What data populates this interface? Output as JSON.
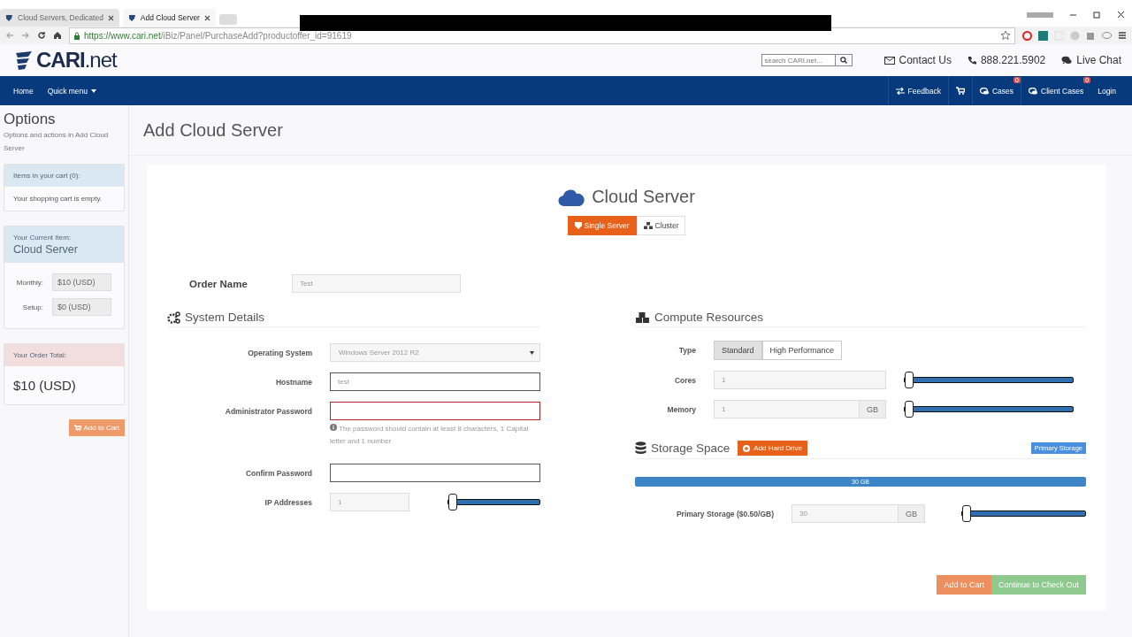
{
  "browser": {
    "tabs": [
      {
        "label": "Cloud Servers, Dedicated",
        "selected": false
      },
      {
        "label": "Add Cloud Server",
        "selected": true
      }
    ],
    "url_host": "https://www.cari.net",
    "url_path": "/iBiz/Panel/PurchaseAdd?productoffer_id=91619"
  },
  "header": {
    "logo_main": "CARI",
    "logo_suffix": ".net",
    "search": {
      "placeholder": "search CARI.net..."
    },
    "links": [
      {
        "label": "Contact Us",
        "kind": "mail"
      },
      {
        "label": "888.221.5902",
        "kind": "phone"
      },
      {
        "label": "Live Chat",
        "kind": "chat"
      }
    ]
  },
  "nav": {
    "left": [
      {
        "label": "Home",
        "kind": "link"
      },
      {
        "label": "Quick menu",
        "kind": "dropdown"
      }
    ],
    "right": [
      {
        "label": "Feedback",
        "kind": "feedback"
      },
      {
        "kind": "cart"
      },
      {
        "label": "Cases",
        "kind": "cases",
        "badge": "0"
      },
      {
        "label": "Client Cases",
        "kind": "cases",
        "badge": "0"
      },
      {
        "label": "Login",
        "kind": "link"
      }
    ]
  },
  "sidebar": {
    "title": "Options",
    "subtitle": "Options and actions in Add Cloud Server",
    "cart": {
      "heading": "Items in your cart (0):",
      "body": "Your shopping cart is empty."
    },
    "current": {
      "heading": "Your Current Item:",
      "name": "Cloud Server",
      "fees": [
        {
          "label": "Monthly:",
          "value": "$10 (USD)"
        },
        {
          "label": "Setup:",
          "value": "$0 (USD)"
        }
      ]
    },
    "total": {
      "heading": "Your Order Total:",
      "amount": "$10 (USD)"
    },
    "button": "Add to Cart"
  },
  "page_title": "Add Cloud Server",
  "product": {
    "title": "Cloud Server",
    "modes": [
      {
        "label": "Single Server",
        "kind": "single",
        "selected": true
      },
      {
        "label": "Cluster",
        "kind": "cluster",
        "selected": false
      }
    ]
  },
  "order_name": {
    "label": "Order Name",
    "value": "Test"
  },
  "system": {
    "title": "System Details",
    "fields": [
      {
        "label": "Operating System",
        "kind": "select",
        "value": "Windows Server 2012 R2",
        "invalid": false
      },
      {
        "label": "Hostname",
        "kind": "text",
        "value": "test",
        "invalid": false
      },
      {
        "label": "Administrator Password",
        "kind": "password",
        "invalid": true,
        "hint": "The password should contain at least 8 characters, 1 Capital letter and 1 number"
      },
      {
        "label": "Confirm Password",
        "kind": "password",
        "invalid": false
      },
      {
        "label": "IP Addresses",
        "kind": "slider",
        "value": "1",
        "level": 0,
        "invalid": false
      }
    ]
  },
  "compute": {
    "title": "Compute Resources",
    "type_label": "Type",
    "types": [
      {
        "label": "Standard",
        "selected": true
      },
      {
        "label": "High Performance",
        "selected": false
      }
    ],
    "fields": [
      {
        "label": "Cores",
        "value": "1",
        "level": 0
      },
      {
        "label": "Memory",
        "value": "1",
        "unit": "GB",
        "level": 0
      }
    ]
  },
  "storage": {
    "title": "Storage Space",
    "add_button": "Add Hard Drive",
    "tag": "Primary Storage",
    "bar": {
      "label": "30 GB",
      "level": 1
    },
    "fields": [
      {
        "label": "Primary Storage ($0.50/GB)",
        "value": "30",
        "unit": "GB",
        "level": 0
      }
    ]
  },
  "actions": [
    {
      "label": "Add to Cart",
      "kind": "secondary"
    },
    {
      "label": "Continue to Check Out",
      "kind": "primary"
    }
  ]
}
